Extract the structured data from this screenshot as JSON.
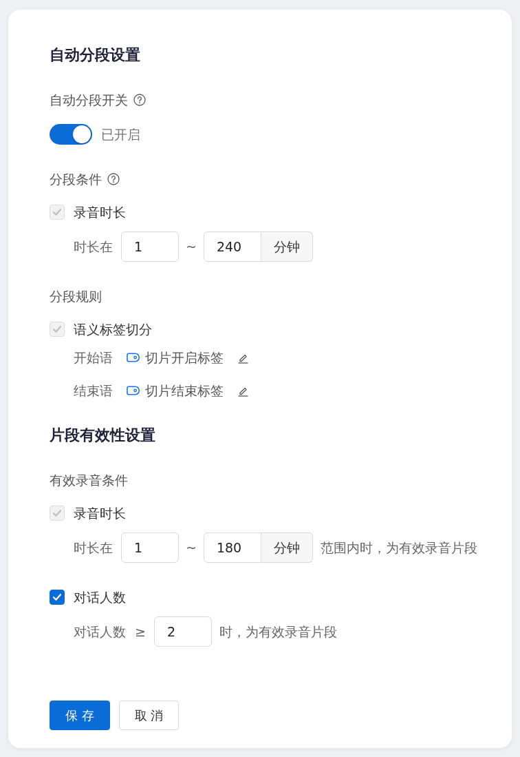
{
  "sections": [
    {
      "title": "自动分段设置",
      "groups": [
        {
          "kind": "switch",
          "label": "自动分段开关",
          "help": true,
          "switch": {
            "on": true,
            "status": "已开启"
          }
        },
        {
          "kind": "options",
          "label": "分段条件",
          "help": true,
          "options": [
            {
              "label": "录音时长",
              "checked": true,
              "disabled": true,
              "details": [
                {
                  "kind": "range",
                  "label": "时长在",
                  "min": "1",
                  "separator": "~",
                  "max": "240",
                  "unit": "分钟"
                }
              ]
            }
          ]
        },
        {
          "kind": "options",
          "label": "分段规则",
          "options": [
            {
              "label": "语义标签切分",
              "checked": true,
              "disabled": true,
              "details": [
                {
                  "kind": "tag",
                  "label": "开始语",
                  "tag": "切片开启标签",
                  "editable": true
                },
                {
                  "kind": "tag",
                  "label": "结束语",
                  "tag": "切片结束标签",
                  "editable": true
                }
              ]
            }
          ]
        }
      ]
    },
    {
      "title": "片段有效性设置",
      "groups": [
        {
          "kind": "options",
          "label": "有效录音条件",
          "options": [
            {
              "label": "录音时长",
              "checked": true,
              "disabled": true,
              "details": [
                {
                  "kind": "range",
                  "label": "时长在",
                  "min": "1",
                  "separator": "~",
                  "max": "180",
                  "unit": "分钟",
                  "suffix": "范围内时，为有效录音片段"
                }
              ]
            },
            {
              "label": "对话人数",
              "checked": true,
              "disabled": false,
              "details": [
                {
                  "kind": "threshold",
                  "label": "对话人数",
                  "operator": "≥",
                  "value": "2",
                  "suffix": "时，为有效录音片段"
                }
              ]
            }
          ]
        }
      ]
    }
  ],
  "actions": [
    {
      "kind": "save",
      "label": "保 存"
    },
    {
      "kind": "cancel",
      "label": "取 消"
    }
  ]
}
